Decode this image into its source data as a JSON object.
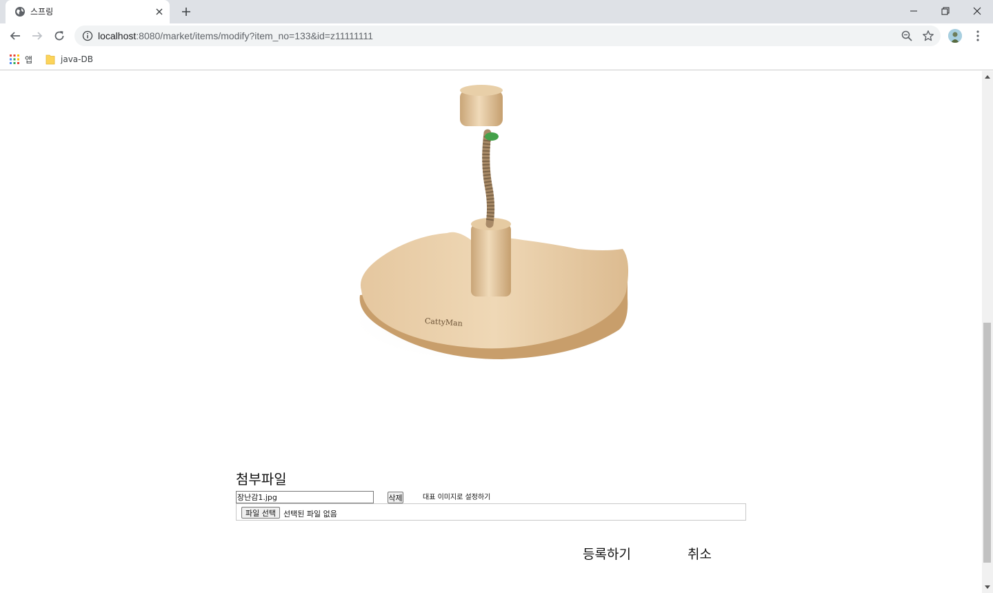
{
  "browser": {
    "tab_title": "스프링",
    "url_host": "localhost",
    "url_rest": ":8080/market/items/modify?item_no=133&id=z11111111"
  },
  "bookmarks": [
    {
      "label": "앱",
      "icon": "apps-grid-icon"
    },
    {
      "label": "java-DB",
      "icon": "folder-icon"
    }
  ],
  "page": {
    "attach_heading": "첨부파일",
    "existing_file_value": "장난감1.jpg",
    "delete_label": "삭제",
    "representative_label": "대표 이미지로 설정하기",
    "choose_file_label": "파일 선택",
    "no_file_label": "선택된 파일 없음",
    "submit_label": "등록하기",
    "cancel_label": "취소"
  },
  "image_text": "CattyMan"
}
